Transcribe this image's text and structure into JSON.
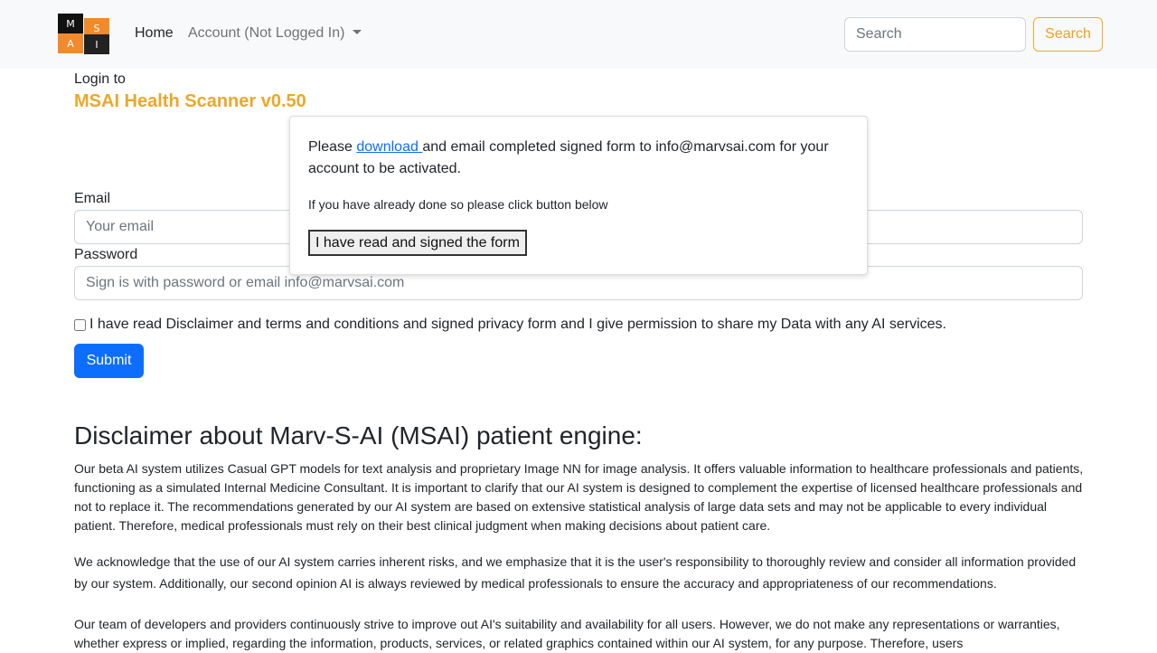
{
  "navbar": {
    "logo_letters": [
      "M",
      "S",
      "A",
      "I"
    ],
    "home_label": "Home",
    "account_label": "Account (Not Logged In)",
    "search_placeholder": "Search",
    "search_button": "Search"
  },
  "login": {
    "intro": "Login to",
    "app_title": "MSAI Health Scanner v0.50",
    "email_label": "Email",
    "email_placeholder": "Your email",
    "password_label": "Password",
    "password_placeholder": "Sign is with password or email info@marvsai.com",
    "consent_label": "I have read Disclaimer and terms and conditions and signed privacy form and I give permission to share my Data with any AI services.",
    "consent_checked": false,
    "submit_label": "Submit"
  },
  "popup": {
    "msg_before": "Please ",
    "link_text": "download ",
    "msg_after": "and email completed signed form to info@marvsai.com for your account to be activated.",
    "sub_text": "If you have already done so please click button below",
    "button_label": "I have read and signed the form"
  },
  "disclaimer": {
    "heading": "Disclaimer about Marv-S-AI (MSAI) patient engine:",
    "paragraph1": "Our beta AI system utilizes Casual GPT models for text analysis and proprietary Image NN for image analysis. It offers valuable information to healthcare professionals and patients, functioning as a simulated Internal Medicine Consultant. It is important to clarify that our AI system is designed to complement the expertise of licensed healthcare professionals and not to replace it. The recommendations generated by our AI system are based on extensive statistical analysis of large data sets and may not be applicable to every individual patient. Therefore, medical professionals must rely on their best clinical judgment when making decisions about patient care.",
    "paragraph2": "We acknowledge that the use of our AI system carries inherent risks, and we emphasize that it is the user's responsibility to thoroughly review and consider all information provided by our system. Additionally, our second opinion AI is always reviewed by medical professionals to ensure the accuracy and appropriateness of our recommendations.",
    "paragraph3": "Our team of developers and providers continuously strive to improve out AI's suitability and availability for all users. However, we do not make any representations or warranties, whether express or implied, regarding the information, products, services, or related graphics contained within our AI system, for any purpose. Therefore, users"
  }
}
